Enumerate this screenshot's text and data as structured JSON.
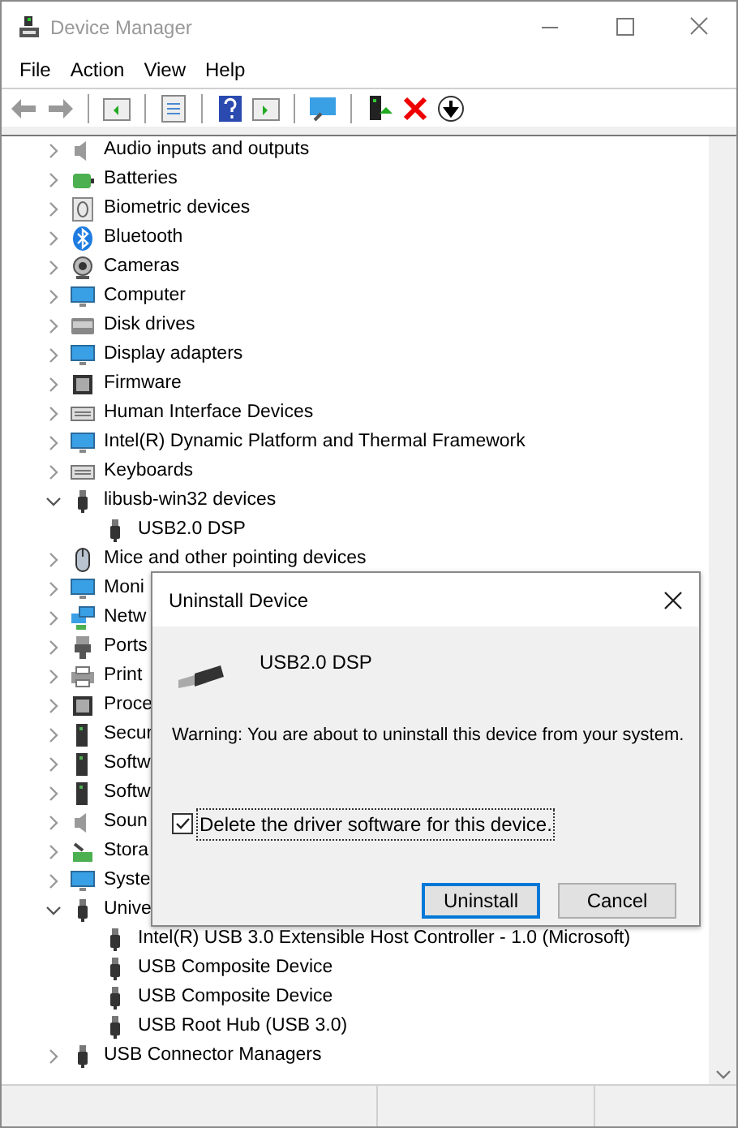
{
  "window": {
    "title": "Device Manager"
  },
  "menu": [
    "File",
    "Action",
    "View",
    "Help"
  ],
  "tree": [
    {
      "label": "Audio inputs and outputs",
      "expanded": false
    },
    {
      "label": "Batteries",
      "expanded": false
    },
    {
      "label": "Biometric devices",
      "expanded": false
    },
    {
      "label": "Bluetooth",
      "expanded": false
    },
    {
      "label": "Cameras",
      "expanded": false
    },
    {
      "label": "Computer",
      "expanded": false
    },
    {
      "label": "Disk drives",
      "expanded": false
    },
    {
      "label": "Display adapters",
      "expanded": false
    },
    {
      "label": "Firmware",
      "expanded": false
    },
    {
      "label": "Human Interface Devices",
      "expanded": false
    },
    {
      "label": "Intel(R) Dynamic Platform and Thermal Framework",
      "expanded": false
    },
    {
      "label": "Keyboards",
      "expanded": false
    },
    {
      "label": "libusb-win32 devices",
      "expanded": true,
      "children": [
        {
          "label": "USB2.0 DSP"
        }
      ]
    },
    {
      "label": "Mice and other pointing devices",
      "expanded": false
    },
    {
      "label": "Moni",
      "expanded": false
    },
    {
      "label": "Netw",
      "expanded": false
    },
    {
      "label": "Ports",
      "expanded": false
    },
    {
      "label": "Print",
      "expanded": false
    },
    {
      "label": "Proce",
      "expanded": false
    },
    {
      "label": "Secur",
      "expanded": false
    },
    {
      "label": "Softw",
      "expanded": false
    },
    {
      "label": "Softw",
      "expanded": false
    },
    {
      "label": "Soun",
      "expanded": false
    },
    {
      "label": "Stora",
      "expanded": false
    },
    {
      "label": "Syste",
      "expanded": false
    },
    {
      "label": "Unive",
      "expanded": true,
      "children": [
        {
          "label": "Intel(R) USB 3.0 Extensible Host Controller - 1.0 (Microsoft)"
        },
        {
          "label": "USB Composite Device"
        },
        {
          "label": "USB Composite Device"
        },
        {
          "label": "USB Root Hub (USB 3.0)"
        }
      ]
    },
    {
      "label": "USB Connector Managers",
      "expanded": false
    }
  ],
  "dialog": {
    "title": "Uninstall Device",
    "device": "USB2.0 DSP",
    "warning": "Warning: You are about to uninstall this device from your system.",
    "checkbox": {
      "label": "Delete the driver software for this device.",
      "checked": true
    },
    "buttons": [
      {
        "label": "Uninstall",
        "default": true
      },
      {
        "label": "Cancel",
        "default": false
      }
    ]
  }
}
